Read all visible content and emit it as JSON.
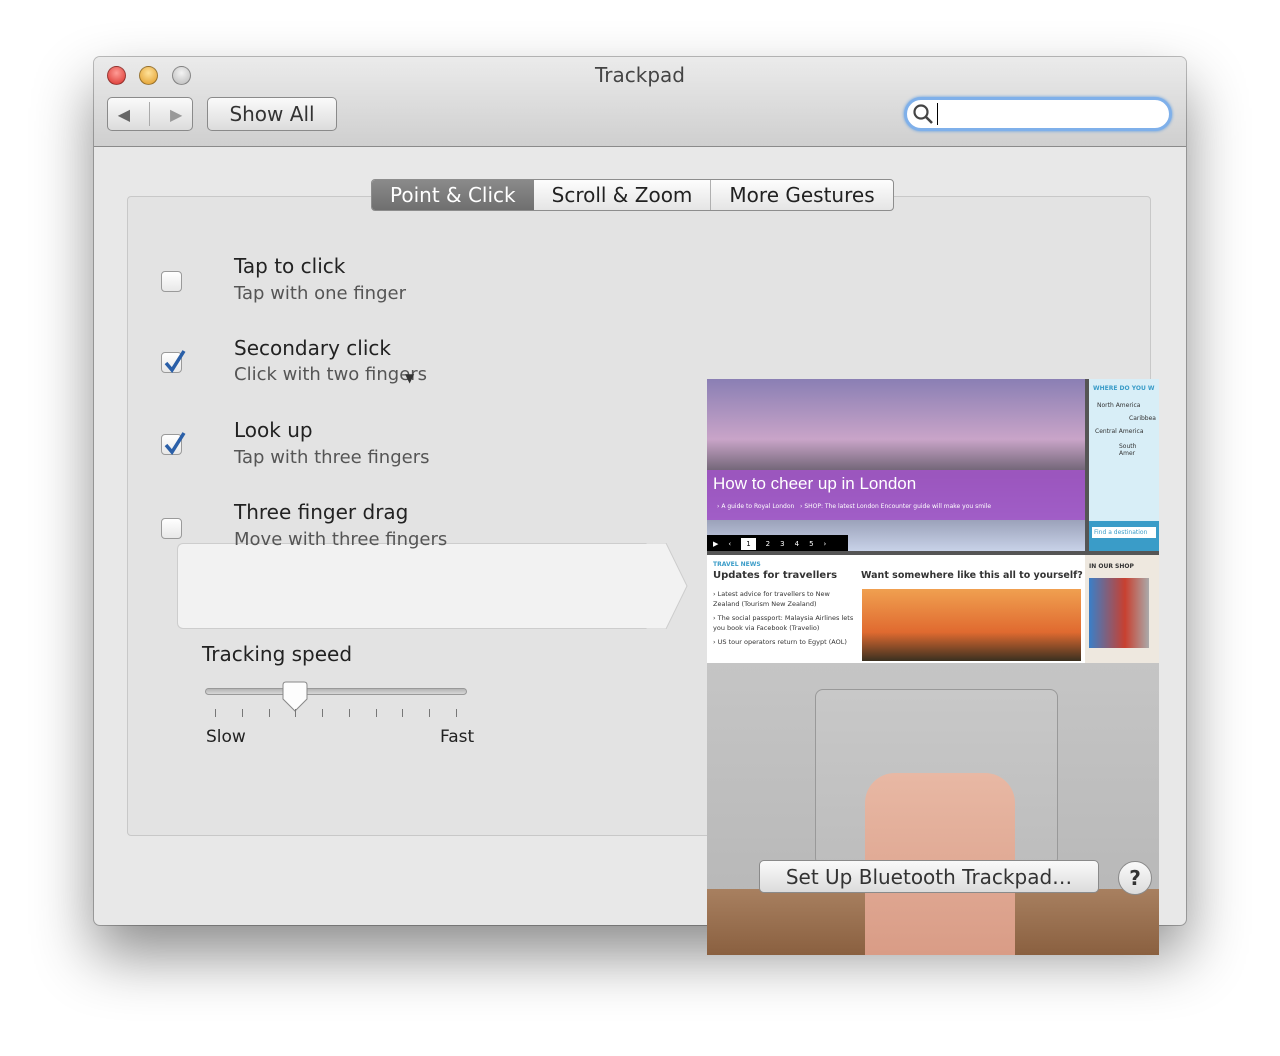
{
  "window": {
    "title": "Trackpad"
  },
  "toolbar": {
    "back_icon": "triangle-left",
    "forward_icon": "triangle-right",
    "show_all_label": "Show All",
    "search": {
      "value": "",
      "placeholder": ""
    }
  },
  "tabs": [
    {
      "label": "Point & Click",
      "selected": true
    },
    {
      "label": "Scroll & Zoom",
      "selected": false
    },
    {
      "label": "More Gestures",
      "selected": false
    }
  ],
  "options": [
    {
      "title": "Tap to click",
      "subtitle": "Tap with one finger",
      "checked": false
    },
    {
      "title": "Secondary click",
      "subtitle": "Click with two fingers",
      "checked": true,
      "has_dropdown": true
    },
    {
      "title": "Look up",
      "subtitle": "Tap with three fingers",
      "checked": true,
      "highlighted": true
    },
    {
      "title": "Three finger drag",
      "subtitle": "Move with three fingers",
      "checked": false
    }
  ],
  "tracking": {
    "label": "Tracking speed",
    "min_label": "Slow",
    "max_label": "Fast",
    "ticks": 10,
    "value_fraction": 0.333
  },
  "preview": {
    "headline": "How to cheer up in London",
    "links": [
      "A guide to Royal London",
      "SHOP: The latest London Encounter guide will make you smile"
    ],
    "pager": [
      "1",
      "2",
      "3",
      "4",
      "5"
    ],
    "side_title": "WHERE DO YOU W",
    "regions": [
      "North America",
      "Caribbea",
      "Central America",
      "South Amer"
    ],
    "find_destination": "Find a destination",
    "news_kicker": "TRAVEL NEWS",
    "news_title": "Updates for travellers",
    "news_items": [
      "Latest advice for travellers to New Zealand (Tourism New Zealand)",
      "The social passport: Malaysia Airlines lets you book via Facebook (Travelio)",
      "US tour operators return to Egypt (AOL)"
    ],
    "promo_title": "Want somewhere like this all to yourself?",
    "shop_title": "IN OUR SHOP"
  },
  "footer": {
    "setup_label": "Set Up Bluetooth Trackpad…",
    "help_label": "?"
  },
  "colors": {
    "close": "#e0443e",
    "minimize": "#e6a73a",
    "zoom": "#c8c8c8",
    "check": "#2a5fa8",
    "purple_banner": "#a254c8"
  }
}
